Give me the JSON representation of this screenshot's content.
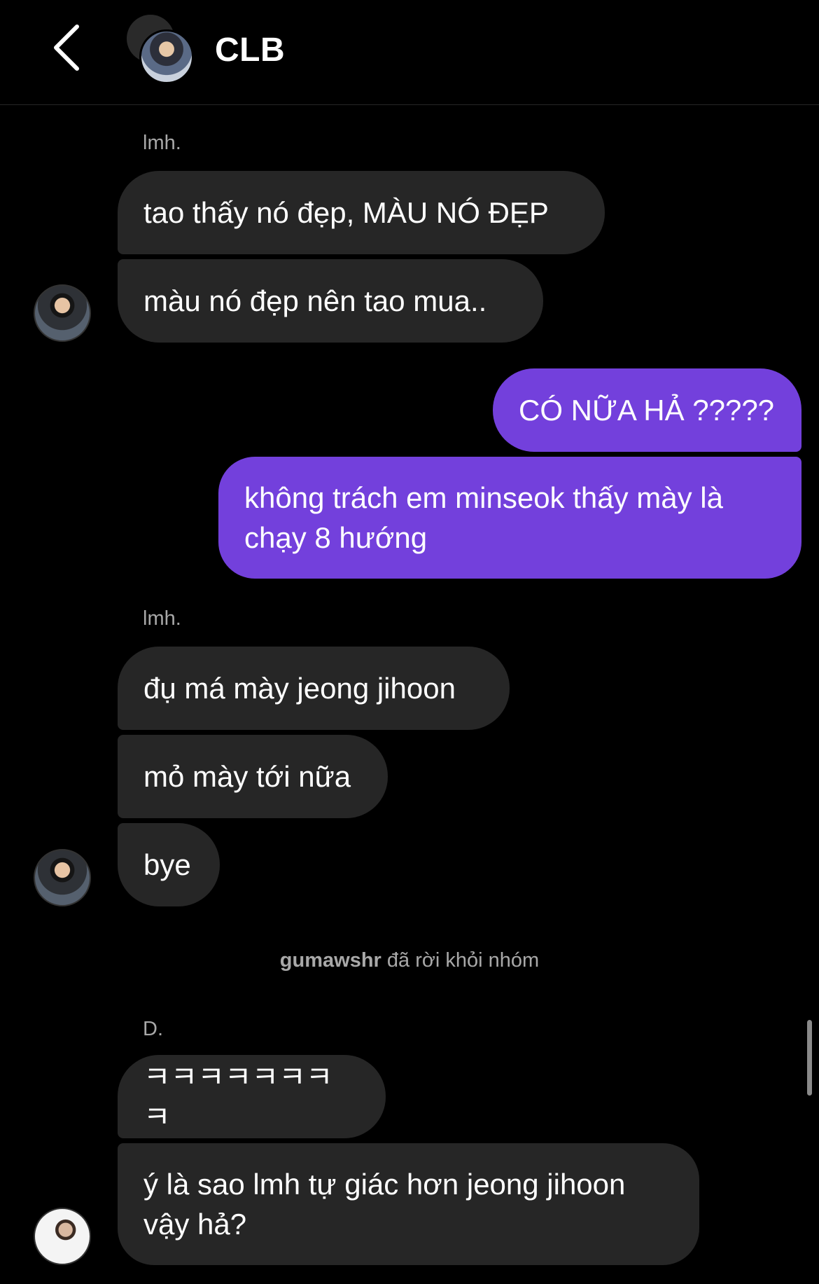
{
  "header": {
    "back_icon": "chevron-left-icon",
    "title": "CLB"
  },
  "messages": [
    {
      "sender": "lmh.",
      "lines": [
        "tao thấy nó đẹp, MÀU NÓ ĐẸP",
        "màu nó đẹp nên tao mua.."
      ]
    },
    {
      "outgoing": [
        "CÓ NỮA HẢ ?????",
        "không trách em minseok thấy mày là\nchạy 8 hướng"
      ]
    },
    {
      "sender": "lmh.",
      "lines": [
        "đụ má mày jeong jihoon",
        "mỏ mày tới nữa",
        "bye"
      ]
    },
    {
      "system": {
        "user": "gumawshr",
        "action": "đã rời khỏi nhóm"
      }
    },
    {
      "sender": "D.",
      "lines": [
        "ㅋㅋㅋㅋㅋㅋㅋㅋ",
        "ý là sao lmh tự giác hơn jeong jihoon\nvậy hả?"
      ]
    }
  ],
  "colors": {
    "background": "#000000",
    "incoming_bubble": "#262626",
    "outgoing_bubble": "#7340dc",
    "secondary_text": "#a8a8a8"
  }
}
